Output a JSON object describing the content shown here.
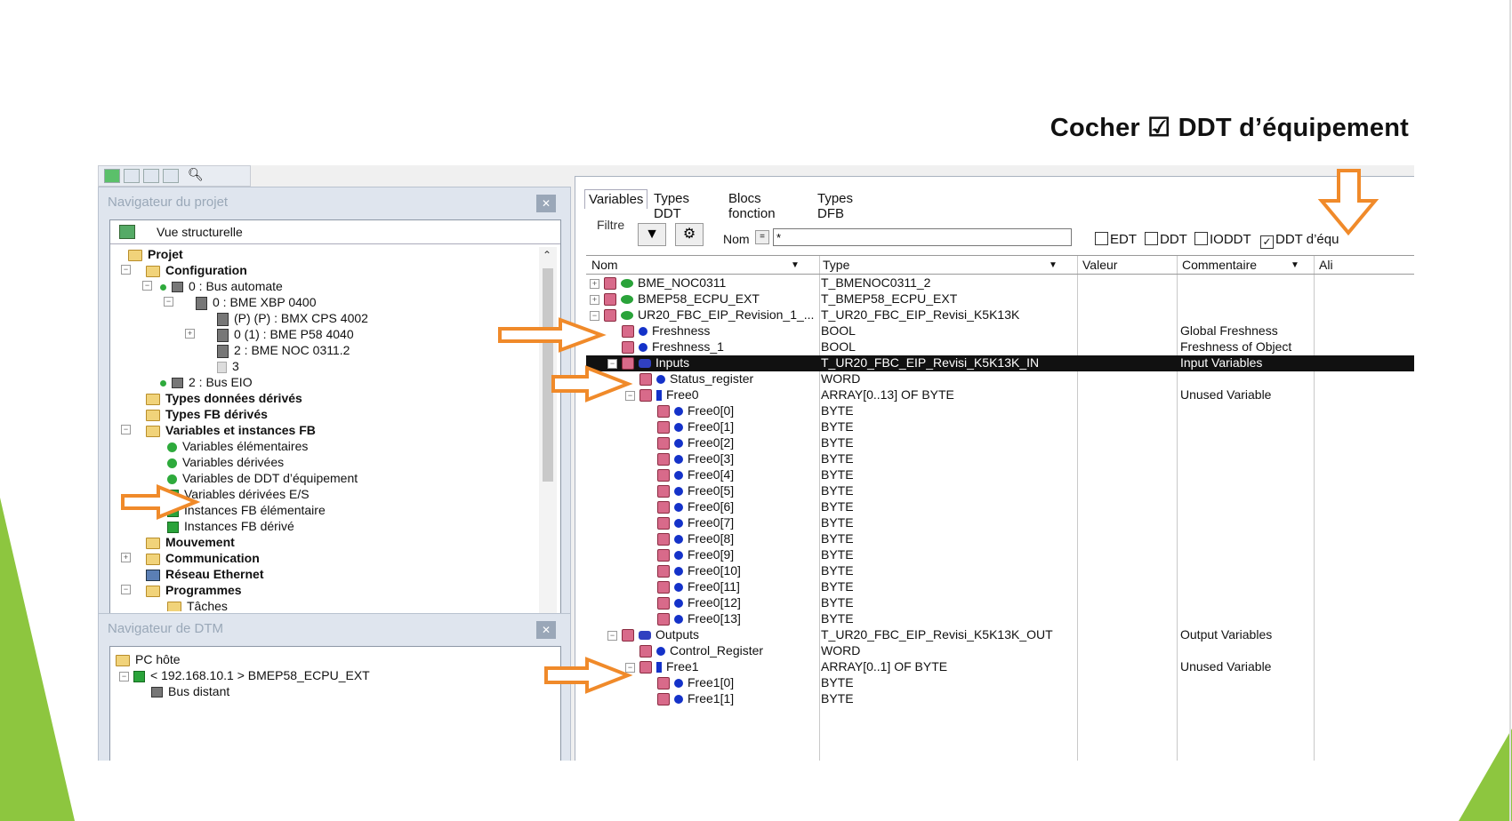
{
  "slide": {
    "title": "Cocher ☑ DDT d’équipement",
    "accent_green": "#8dc63f",
    "arrow_color": "#f08a2a"
  },
  "left_panel": {
    "title": "Navigateur du projet",
    "view": "Vue structurelle",
    "tree": [
      {
        "label": "Projet",
        "bold": true
      },
      {
        "label": "Configuration",
        "bold": true
      },
      {
        "label": "0 : Bus automate",
        "bold": false
      },
      {
        "label": "0 : BME XBP 0400",
        "bold": false
      },
      {
        "label": "(P) (P) : BMX CPS 4002",
        "bold": false
      },
      {
        "label": "0 (1) : BME P58 4040",
        "bold": false
      },
      {
        "label": "2 : BME NOC 0311.2",
        "bold": false
      },
      {
        "label": "3",
        "bold": false
      },
      {
        "label": "2 : Bus EIO",
        "bold": false
      },
      {
        "label": "Types données dérivés",
        "bold": true
      },
      {
        "label": "Types FB dérivés",
        "bold": true
      },
      {
        "label": "Variables et instances FB",
        "bold": true
      },
      {
        "label": "Variables élémentaires",
        "bold": false
      },
      {
        "label": "Variables dérivées",
        "bold": false
      },
      {
        "label": "Variables de DDT d’équipement",
        "bold": false
      },
      {
        "label": "Variables dérivées E/S",
        "bold": false
      },
      {
        "label": "Instances FB élémentaire",
        "bold": false
      },
      {
        "label": "Instances FB dérivé",
        "bold": false
      },
      {
        "label": "Mouvement",
        "bold": true
      },
      {
        "label": "Communication",
        "bold": true
      },
      {
        "label": "Réseau Ethernet",
        "bold": true
      },
      {
        "label": "Programmes",
        "bold": true
      },
      {
        "label": "Tâches",
        "bold": false
      }
    ]
  },
  "dtm_panel": {
    "title": "Navigateur de DTM",
    "items": [
      "PC hôte",
      "< 192.168.10.1 > BMEP58_ECPU_EXT",
      "Bus distant"
    ]
  },
  "right_panel": {
    "tabs": [
      "Variables",
      "Types DDT",
      "Blocs fonction",
      "Types DFB"
    ],
    "filter_label": "Filtre",
    "nom_label": "Nom",
    "nom_dropdown": "=",
    "filter_value": "*",
    "checkboxes": [
      {
        "label": "EDT",
        "checked": false
      },
      {
        "label": "DDT",
        "checked": false
      },
      {
        "label": "IODDT",
        "checked": false
      },
      {
        "label": "DDT d’équ",
        "checked": true
      }
    ],
    "columns": [
      "Nom",
      "Type",
      "Valeur",
      "Commentaire",
      "Ali"
    ],
    "rows": [
      {
        "name": "BME_NOC0311",
        "type": "T_BMENOC0311_2",
        "comment": ""
      },
      {
        "name": "BMEP58_ECPU_EXT",
        "type": "T_BMEP58_ECPU_EXT",
        "comment": ""
      },
      {
        "name": "UR20_FBC_EIP_Revision_1_...",
        "type": "T_UR20_FBC_EIP_Revisi_K5K13K",
        "comment": ""
      },
      {
        "name": "Freshness",
        "type": "BOOL",
        "comment": "Global Freshness"
      },
      {
        "name": "Freshness_1",
        "type": "BOOL",
        "comment": "Freshness of Object"
      },
      {
        "name": "Inputs",
        "type": "T_UR20_FBC_EIP_Revisi_K5K13K_IN",
        "comment": "Input Variables"
      },
      {
        "name": "Status_register",
        "type": "WORD",
        "comment": ""
      },
      {
        "name": "Free0",
        "type": "ARRAY[0..13] OF BYTE",
        "comment": "Unused Variable"
      },
      {
        "name": "Free0[0]",
        "type": "BYTE",
        "comment": ""
      },
      {
        "name": "Free0[1]",
        "type": "BYTE",
        "comment": ""
      },
      {
        "name": "Free0[2]",
        "type": "BYTE",
        "comment": ""
      },
      {
        "name": "Free0[3]",
        "type": "BYTE",
        "comment": ""
      },
      {
        "name": "Free0[4]",
        "type": "BYTE",
        "comment": ""
      },
      {
        "name": "Free0[5]",
        "type": "BYTE",
        "comment": ""
      },
      {
        "name": "Free0[6]",
        "type": "BYTE",
        "comment": ""
      },
      {
        "name": "Free0[7]",
        "type": "BYTE",
        "comment": ""
      },
      {
        "name": "Free0[8]",
        "type": "BYTE",
        "comment": ""
      },
      {
        "name": "Free0[9]",
        "type": "BYTE",
        "comment": ""
      },
      {
        "name": "Free0[10]",
        "type": "BYTE",
        "comment": ""
      },
      {
        "name": "Free0[11]",
        "type": "BYTE",
        "comment": ""
      },
      {
        "name": "Free0[12]",
        "type": "BYTE",
        "comment": ""
      },
      {
        "name": "Free0[13]",
        "type": "BYTE",
        "comment": ""
      },
      {
        "name": "Outputs",
        "type": "T_UR20_FBC_EIP_Revisi_K5K13K_OUT",
        "comment": "Output Variables"
      },
      {
        "name": "Control_Register",
        "type": "WORD",
        "comment": ""
      },
      {
        "name": "Free1",
        "type": "ARRAY[0..1] OF BYTE",
        "comment": "Unused Variable"
      },
      {
        "name": "Free1[0]",
        "type": "BYTE",
        "comment": ""
      },
      {
        "name": "Free1[1]",
        "type": "BYTE",
        "comment": ""
      }
    ]
  }
}
